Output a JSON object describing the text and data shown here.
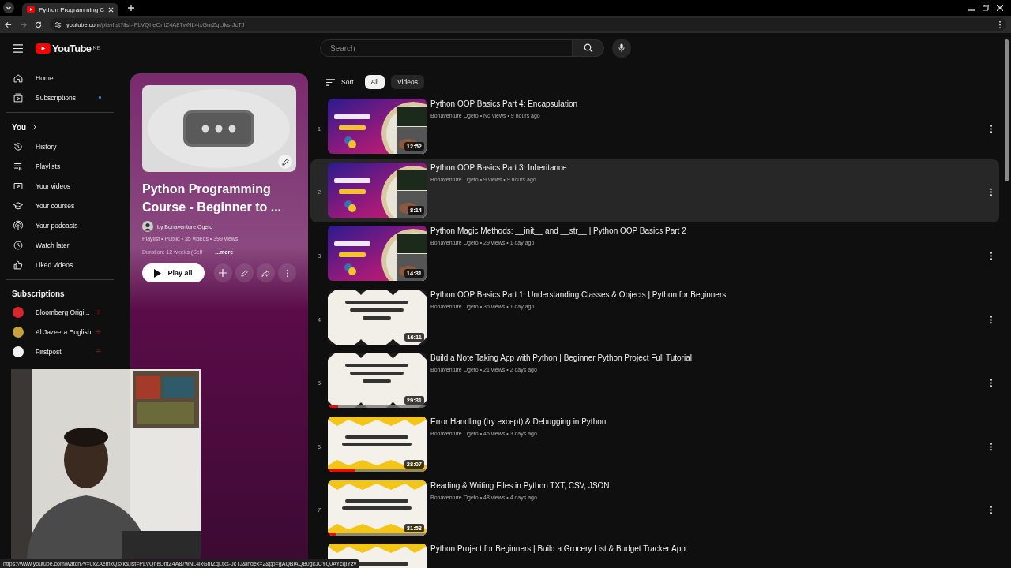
{
  "browser": {
    "tab_title": "Python Programming C",
    "address": {
      "domain": "youtube.com",
      "path": "/playlist?list=PLVQheOntZ4A87wNL4ixGnrZqLtks-JcTJ"
    },
    "forward_disabled": true
  },
  "masthead": {
    "logo": "YouTube",
    "region": "KE",
    "search": {
      "placeholder": "Search"
    }
  },
  "sidebar": {
    "main": [
      {
        "label": "Home",
        "new_content": false
      },
      {
        "label": "Subscriptions",
        "new_content": true
      }
    ],
    "you": {
      "title": "You",
      "items": [
        {
          "label": "History"
        },
        {
          "label": "Playlists"
        },
        {
          "label": "Your videos"
        },
        {
          "label": "Your courses"
        },
        {
          "label": "Your podcasts"
        },
        {
          "label": "Watch later"
        },
        {
          "label": "Liked videos"
        }
      ]
    },
    "subscriptions": {
      "title": "Subscriptions",
      "items": [
        {
          "name": "Bloomberg Origi...",
          "color": "#d8262c"
        },
        {
          "name": "Al Jazeera English",
          "color": "#c9a13c"
        },
        {
          "name": "Firstpost",
          "color": "#f2f2f2"
        }
      ]
    }
  },
  "playlist": {
    "title": "Python Programming Course - Beginner to ...",
    "owner": "by Bonaventure Ogeto",
    "meta": "Playlist • Public • 35 videos • 399 views",
    "description": "Duration: 12 weeks (Self",
    "more": "...more",
    "play_all": "Play all"
  },
  "filters": {
    "sort": "Sort",
    "chips": [
      {
        "label": "All",
        "selected": true
      },
      {
        "label": "Videos",
        "selected": false
      }
    ]
  },
  "videos": [
    {
      "index": "1",
      "title": "Python OOP Basics Part 4: Encapsulation",
      "meta": "Bonaventure Ogeto • No views • 9 hours ago",
      "duration": "12:52",
      "highlighted": false
    },
    {
      "index": "2",
      "title": "Python OOP Basics Part 3: Inheritance",
      "meta": "Bonaventure Ogeto • 9 views • 9 hours ago",
      "duration": "8:14",
      "highlighted": true
    },
    {
      "index": "3",
      "title": "Python Magic Methods: __init__ and __str__ | Python OOP Basics Part 2",
      "meta": "Bonaventure Ogeto • 29 views • 1 day ago",
      "duration": "14:31",
      "highlighted": false
    },
    {
      "index": "4",
      "title": "Python OOP Basics Part 1: Understanding Classes & Objects | Python for Beginners",
      "meta": "Bonaventure Ogeto • 36 views • 1 day ago",
      "duration": "16:11",
      "highlighted": false
    },
    {
      "index": "5",
      "title": "Build a Note Taking App with Python | Beginner Python Project Full Tutorial",
      "meta": "Bonaventure Ogeto • 21 views • 2 days ago",
      "duration": "29:31",
      "highlighted": false,
      "level": 0.1
    },
    {
      "index": "6",
      "title": "Error Handling (try except) & Debugging in Python",
      "meta": "Bonaventure Ogeto • 45 views • 3 days ago",
      "duration": "28:07",
      "highlighted": false,
      "level": 0.27
    },
    {
      "index": "7",
      "title": "Reading & Writing Files in Python TXT, CSV, JSON",
      "meta": "Bonaventure Ogeto • 48 views • 4 days ago",
      "duration": "31:53",
      "highlighted": false,
      "level": 0.08
    },
    {
      "title": "Python Project for Beginners | Build a Grocery List & Budget Tracker App",
      "highlighted": false
    }
  ],
  "status_url": "https://www.youtube.com/watch?v=0xZAemxQsxk&list=PLVQheOntZ4A87wNL4ixGnrZqLtks-JcTJ&index=2&pp=gAQBiAQB0gcJCYQJAYcqIYzv"
}
